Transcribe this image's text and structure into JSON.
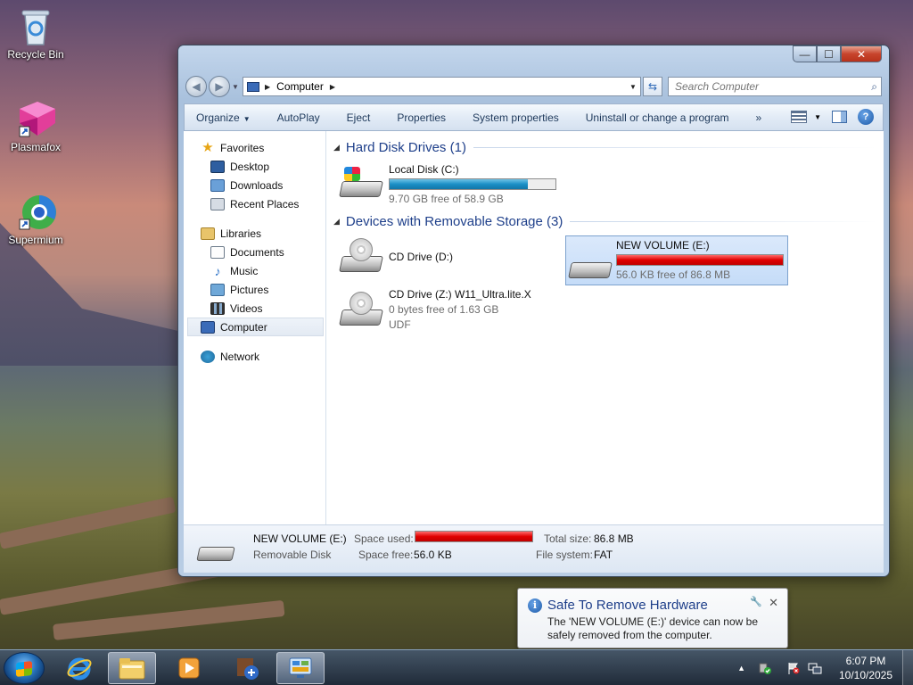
{
  "desktop": {
    "icons": [
      {
        "label": "Recycle Bin",
        "icon": "recycle-bin-icon"
      },
      {
        "label": "Plasmafox",
        "icon": "plasmafox-icon"
      },
      {
        "label": "Supermium",
        "icon": "supermium-icon"
      }
    ]
  },
  "window": {
    "controls": {
      "minimize": "—",
      "maximize": "☐",
      "close": "✕"
    },
    "address": {
      "segment": "Computer"
    },
    "search": {
      "placeholder": "Search Computer"
    },
    "toolbar": {
      "organize": "Organize",
      "autoplay": "AutoPlay",
      "eject": "Eject",
      "properties": "Properties",
      "system_properties": "System properties",
      "uninstall": "Uninstall or change a program",
      "more": "»"
    },
    "nav": {
      "favorites": "Favorites",
      "desktop": "Desktop",
      "downloads": "Downloads",
      "recent_places": "Recent Places",
      "libraries": "Libraries",
      "documents": "Documents",
      "music": "Music",
      "pictures": "Pictures",
      "videos": "Videos",
      "computer": "Computer",
      "network": "Network"
    },
    "groups": {
      "hdd_title": "Hard Disk Drives (1)",
      "removable_title": "Devices with Removable Storage (3)"
    },
    "drives": {
      "c": {
        "name": "Local Disk (C:)",
        "free": "9.70 GB free of 58.9 GB",
        "used_fraction": 0.835
      },
      "d": {
        "name": "CD Drive (D:)"
      },
      "e": {
        "name": "NEW VOLUME (E:)",
        "free": "56.0 KB free of 86.8 MB",
        "used_fraction": 0.999
      },
      "z": {
        "name": "CD Drive (Z:) W11_Ultra.lite.X",
        "free": "0 bytes free of 1.63 GB",
        "fs": "UDF"
      }
    },
    "details": {
      "name": "NEW VOLUME (E:)",
      "type": "Removable Disk",
      "space_used_label": "Space used:",
      "space_free_label": "Space free:",
      "space_free_value": "56.0 KB",
      "total_size_label": "Total size:",
      "total_size_value": "86.8 MB",
      "fs_label": "File system:",
      "fs_value": "FAT",
      "used_fraction": 0.999
    }
  },
  "balloon": {
    "title": "Safe To Remove Hardware",
    "message": "The 'NEW VOLUME (E:)' device can now be safely removed from the computer.",
    "close": "✕"
  },
  "taskbar": {
    "apps": [
      "internet-explorer-icon",
      "file-explorer-icon",
      "media-player-icon",
      "setup-tool-icon",
      "control-panel-icon"
    ],
    "clock": {
      "time": "6:07 PM",
      "date": "10/10/2025"
    }
  }
}
